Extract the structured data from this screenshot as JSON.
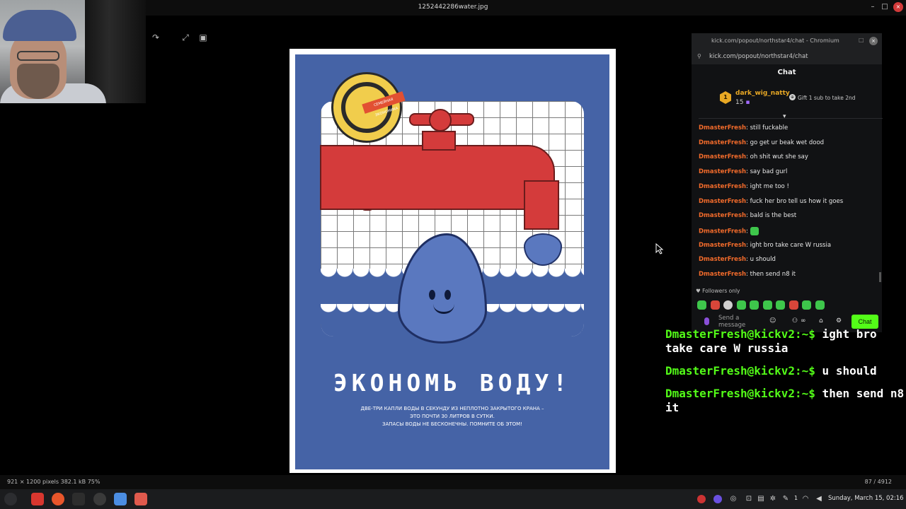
{
  "viewer": {
    "title": "1252442286water.jpg",
    "status_info": "921 × 1200 pixels  382.1 kB  75%",
    "page_counter": "87 / 4912"
  },
  "poster": {
    "heading": "ЭКОНОМЬ ВОДУ!",
    "caption_line1": "ДВЕ-ТРИ КАПЛИ ВОДЫ В СЕКУНДУ ИЗ НЕПЛОТНО ЗАКРЫТОГО КРАНА –",
    "caption_line2": "ЭТО ПОЧТИ 30 ЛИТРОВ В СУТКИ.",
    "caption_line3": "ЗАПАСЫ ВОДЫ НЕ БЕСКОНЕЧНЫ.  ПОМНИТЕ ОБ ЭТОМ!",
    "badge_text": "СЕМЕЙНАЯ ЭКОНОМИКА"
  },
  "chat_window": {
    "titlebar": "kick.com/popout/northstar4/chat - Chromium",
    "url": "kick.com/popout/northstar4/chat",
    "header": "Chat",
    "pinned": {
      "rank": "1",
      "user": "dark_wig_natty",
      "count": "15",
      "gift_text": "Gift 1 sub to take 2nd"
    },
    "messages": [
      {
        "user": "DmasterFresh",
        "text": ": still fuckable"
      },
      {
        "user": "DmasterFresh",
        "text": ": go get ur beak wet dood"
      },
      {
        "user": "DmasterFresh",
        "text": ": oh shit wut she say"
      },
      {
        "user": "DmasterFresh",
        "text": ": say bad gurl"
      },
      {
        "user": "DmasterFresh",
        "text": ": ight me too !"
      },
      {
        "user": "DmasterFresh",
        "text": ": fuck her bro tell us how it goes"
      },
      {
        "user": "DmasterFresh",
        "text": ": bald is the best"
      },
      {
        "user": "DmasterFresh",
        "text": ": "
      },
      {
        "user": "DmasterFresh",
        "text": ": ight bro take care W russia"
      },
      {
        "user": "DmasterFresh",
        "text": ": u should"
      },
      {
        "user": "DmasterFresh",
        "text": ": then send n8 it"
      }
    ],
    "followers_only": "Followers only",
    "input_placeholder": "Send a message",
    "send_label": "Chat"
  },
  "terminal": {
    "lines": [
      {
        "prompt": "DmasterFresh@kickv2:~$",
        "text": " ight bro take care W russia"
      },
      {
        "prompt": "DmasterFresh@kickv2:~$",
        "text": " u should"
      },
      {
        "prompt": "DmasterFresh@kickv2:~$",
        "text": " then send n8 it"
      }
    ]
  },
  "taskbar": {
    "clock": "Sunday, March 15, 02:16",
    "badge": "1"
  },
  "colors": {
    "accent_green": "#53fc18",
    "chat_username": "#f26b2b",
    "poster_blue": "#4563a6",
    "tap_red": "#d43b3b"
  }
}
